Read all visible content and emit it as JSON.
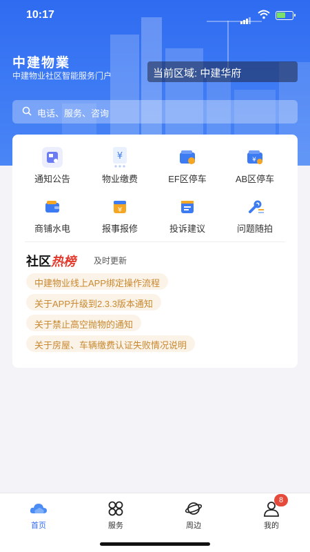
{
  "status_bar": {
    "time": "10:17"
  },
  "header": {
    "brand": "中建物業",
    "subtitle": "中建物业社区智能服务门户",
    "area_label": "当前区域: 中建华府"
  },
  "search": {
    "placeholder": "电话、服务、咨询"
  },
  "services": [
    {
      "label": "通知公告",
      "icon": "notice-icon",
      "color": "#6b7cf2"
    },
    {
      "label": "物业缴费",
      "icon": "yen-bill-icon",
      "color": "#3d7bf2"
    },
    {
      "label": "EF区停车",
      "icon": "parking-wallet-icon",
      "color": "#3d7bf2"
    },
    {
      "label": "AB区停车",
      "icon": "parking-wallet-icon",
      "color": "#3d7bf2"
    },
    {
      "label": "商铺水电",
      "icon": "wallet-icon",
      "color": "#3d7bf2"
    },
    {
      "label": "报事报修",
      "icon": "repair-yen-icon",
      "color": "#3d7bf2"
    },
    {
      "label": "投诉建议",
      "icon": "complaint-icon",
      "color": "#3d7bf2"
    },
    {
      "label": "问题随拍",
      "icon": "wrench-icon",
      "color": "#3d7bf2"
    }
  ],
  "hot": {
    "title_a": "社区",
    "title_b": "热榜",
    "subtitle": "及时更新",
    "items": [
      "中建物业线上APP绑定操作流程",
      "关于APP升级到2.3.3版本通知",
      "关于禁止高空抛物的通知",
      "关于房屋、车辆缴费认证失败情况说明"
    ]
  },
  "tabbar": {
    "tabs": [
      {
        "label": "首页",
        "icon": "cloud-home-icon",
        "active": true
      },
      {
        "label": "服务",
        "icon": "services-grid-icon",
        "active": false
      },
      {
        "label": "周边",
        "icon": "planet-icon",
        "active": false
      },
      {
        "label": "我的",
        "icon": "profile-icon",
        "active": false
      }
    ],
    "badge": "8"
  },
  "colors": {
    "primary": "#2f6bf0",
    "hot_red": "#e23b2e",
    "pill_text": "#c9882f",
    "pill_bg": "#fbf3e8",
    "badge": "#e64a3b"
  }
}
